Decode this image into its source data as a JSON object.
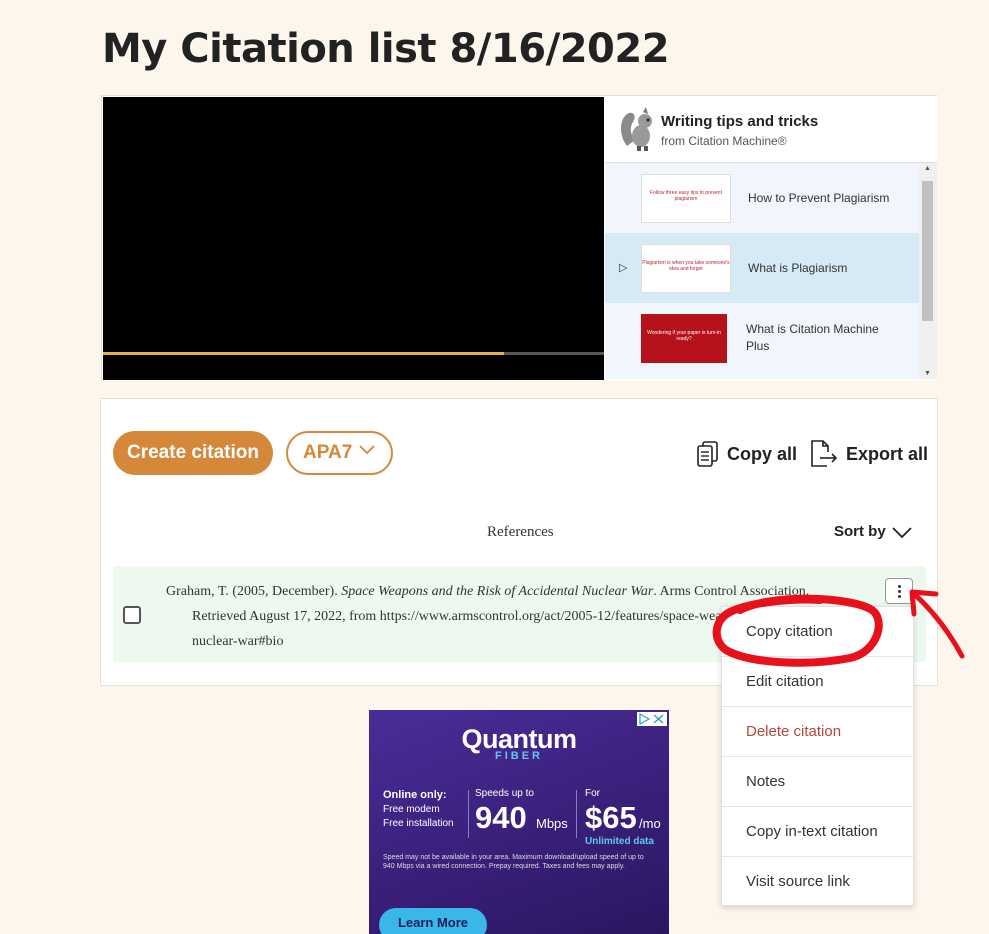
{
  "page": {
    "title": "My Citation list 8/16/2022"
  },
  "video": {
    "progress": 0.8,
    "playlist": {
      "title": "Writing tips and tricks",
      "subtitle": "from Citation Machine®",
      "items": [
        {
          "label": "How to Prevent Plagiarism",
          "thumb_text": "Follow three easy tips to prevent plagiarism",
          "active": false
        },
        {
          "label": "What is Plagiarism",
          "thumb_text": "Plagiarism is when you take someone's idea and forget",
          "active": true
        },
        {
          "label": "What is Citation Machine Plus",
          "thumb_text": "Wondering if your paper is turn-in ready?",
          "active": false
        }
      ]
    }
  },
  "toolbar": {
    "create_label": "Create citation",
    "style_label": "APA7",
    "copy_all_label": "Copy all",
    "export_all_label": "Export all"
  },
  "list": {
    "header": "References",
    "sort_label": "Sort by",
    "citations": [
      {
        "author_date": "Graham, T. (2005, December). ",
        "title": "Space Weapons and the Risk of Accidental Nuclear War",
        "rest_line1": ". Arms Control Association.",
        "line2": "Retrieved August 17, 2022, from https://www.armscontrol.org/act/2005-12/features/space-wea",
        "line3": "nuclear-war#bio"
      }
    ]
  },
  "menu": {
    "items": [
      {
        "label": "Copy citation"
      },
      {
        "label": "Edit citation"
      },
      {
        "label": "Delete citation"
      },
      {
        "label": "Notes"
      },
      {
        "label": "Copy in-text citation"
      },
      {
        "label": "Visit source link"
      }
    ]
  },
  "ad": {
    "brand": "Quantum",
    "brand_sub": "FIBER",
    "online_only": "Online only:",
    "perk1": "Free modem",
    "perk2": "Free installation",
    "speed_label": "Speeds up to",
    "speed": "940",
    "speed_unit": "Mbps",
    "price_label": "For",
    "price": "$65",
    "price_unit": "/mo",
    "unlimited": "Unlimited data",
    "fine_print": "Speed may not be available in your area. Maximum download/upload speed of up to 940 Mbps via a wired connection. Prepay required. Taxes and fees may apply.",
    "cta": "Learn More"
  },
  "colors": {
    "accent": "#d5873a",
    "background": "#fdf6ec",
    "row_highlight": "#edf9ee",
    "danger": "#b8453b",
    "annotation": "#e8101a"
  }
}
